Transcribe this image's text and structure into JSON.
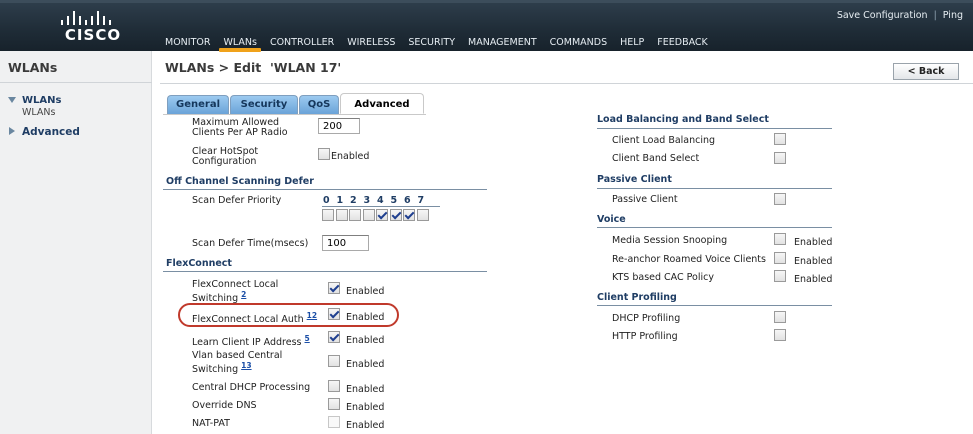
{
  "brand": {
    "logo_text": "CISCO"
  },
  "nav": {
    "items": [
      {
        "label": "MONITOR",
        "active": false
      },
      {
        "label": "WLANs",
        "active": true
      },
      {
        "label": "CONTROLLER",
        "active": false
      },
      {
        "label": "WIRELESS",
        "active": false
      },
      {
        "label": "SECURITY",
        "active": false
      },
      {
        "label": "MANAGEMENT",
        "active": false
      },
      {
        "label": "COMMANDS",
        "active": false
      },
      {
        "label": "HELP",
        "active": false
      },
      {
        "label": "FEEDBACK",
        "active": false
      }
    ]
  },
  "toplinks": {
    "save": "Save Configuration",
    "separator": "|",
    "ping": "Ping"
  },
  "sidebar": {
    "title": "WLANs",
    "tree": {
      "wlans": "WLANs",
      "wlans_sub": "WLANs",
      "advanced": "Advanced"
    }
  },
  "main": {
    "title": "WLANs > Edit  'WLAN 17'",
    "back_label": "< Back",
    "tabs": [
      {
        "label": "General"
      },
      {
        "label": "Security"
      },
      {
        "label": "QoS"
      },
      {
        "label": "Advanced",
        "active": true
      }
    ]
  },
  "left_form": {
    "max_clients_label_1": "Maximum Allowed",
    "max_clients_label_2": "Clients Per AP Radio",
    "max_clients_value": "200",
    "clear_hotspot_label_1": "Clear HotSpot",
    "clear_hotspot_label_2": "Configuration",
    "clear_hotspot_enabled_label": "Enabled",
    "clear_hotspot_checked": false,
    "off_channel_section": "Off Channel Scanning Defer",
    "scan_defer_priority_label": "Scan Defer Priority",
    "priorities": [
      "0",
      "1",
      "2",
      "3",
      "4",
      "5",
      "6",
      "7"
    ],
    "priority_checked": [
      false,
      false,
      false,
      false,
      true,
      true,
      true,
      false
    ],
    "scan_defer_time_label": "Scan Defer Time(msecs)",
    "scan_defer_time_value": "100",
    "flexconnect_section": "FlexConnect",
    "flex_rows": [
      {
        "label_1": "FlexConnect Local",
        "label_2": "Switching",
        "sup": "2",
        "checked": true,
        "enabled": "Enabled"
      },
      {
        "label_1": "FlexConnect Local Auth",
        "sup": "12",
        "checked": true,
        "enabled": "Enabled"
      },
      {
        "label_1": "Learn Client IP Address",
        "sup": "5",
        "checked": true,
        "enabled": "Enabled"
      },
      {
        "label_1": "Vlan based Central",
        "label_2": "Switching",
        "sup": "13",
        "checked": false,
        "enabled": "Enabled"
      },
      {
        "label_1": "Central DHCP Processing",
        "checked": false,
        "enabled": "Enabled"
      },
      {
        "label_1": "Override DNS",
        "checked": false,
        "enabled": "Enabled"
      },
      {
        "label_1": "NAT-PAT",
        "checked": false,
        "enabled": "Enabled"
      }
    ]
  },
  "right_form": {
    "lb_section": "Load Balancing and Band Select",
    "client_load_balancing": "Client Load Balancing",
    "client_band_select": "Client Band Select",
    "passive_section": "Passive Client",
    "passive_client": "Passive Client",
    "voice_section": "Voice",
    "voice_rows": [
      {
        "label": "Media Session Snooping",
        "enabled": "Enabled"
      },
      {
        "label": "Re-anchor Roamed Voice Clients",
        "enabled": "Enabled"
      },
      {
        "label": "KTS based CAC Policy",
        "enabled": "Enabled"
      }
    ],
    "profiling_section": "Client Profiling",
    "dhcp_profiling": "DHCP Profiling",
    "http_profiling": "HTTP Profiling"
  },
  "colors": {
    "accent_underline": "#f0a21a",
    "highlight_oval": "#c0392b",
    "section_text": "#1f3d64"
  }
}
